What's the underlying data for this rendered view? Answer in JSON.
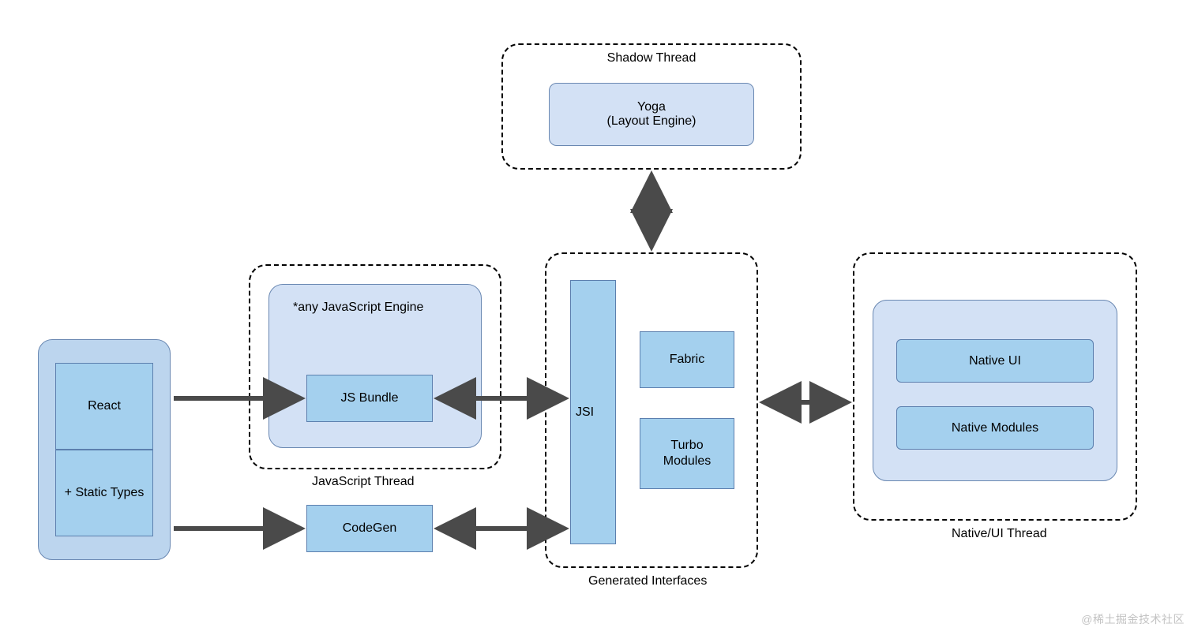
{
  "groups": {
    "shadow_thread": {
      "label": "Shadow Thread"
    },
    "javascript_thread": {
      "label": "JavaScript Thread"
    },
    "generated_interfaces": {
      "label": "Generated Interfaces"
    },
    "native_thread": {
      "label": "Native/UI Thread"
    }
  },
  "panels": {
    "js_engine": {
      "label": "*any JavaScript Engine"
    },
    "yoga": {
      "line1": "Yoga",
      "line2": "(Layout Engine)"
    },
    "native_panel": {}
  },
  "boxes": {
    "react": "React",
    "static_types": "+ Static Types",
    "js_bundle": "JS Bundle",
    "codegen": "CodeGen",
    "jsi": "JSI",
    "fabric": "Fabric",
    "turbo_modules": "Turbo\nModules",
    "native_ui": "Native UI",
    "native_modules": "Native Modules"
  },
  "watermark": "@稀土掘金技术社区"
}
